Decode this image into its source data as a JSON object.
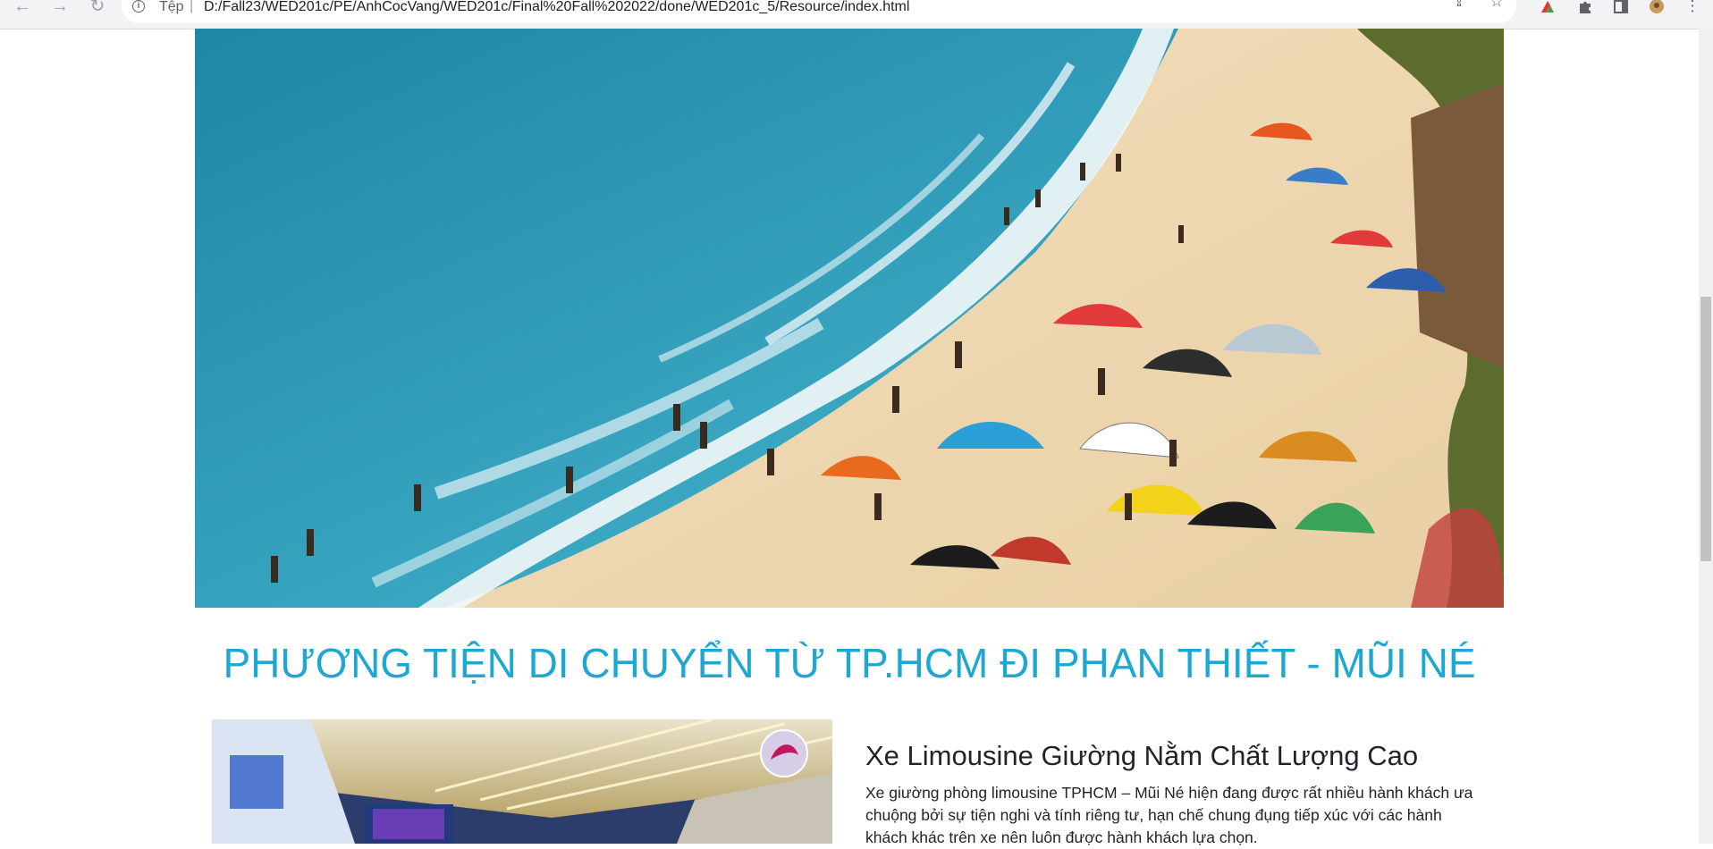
{
  "browser": {
    "nav": {
      "back_icon": "back-arrow-icon",
      "forward_icon": "forward-arrow-icon",
      "reload_icon": "reload-icon"
    },
    "address_bar": {
      "scheme_label": "Tệp",
      "separator": "|",
      "url": "D:/Fall23/WED201c/PE/AnhCocVang/WED201c/Final%20Fall%202022/done/WED201c_5/Resource/index.html"
    },
    "toolbar_icons": [
      "share-icon",
      "bookmark-star-icon",
      "extension-logo-icon",
      "puzzle-extensions-icon",
      "side-panel-icon",
      "profile-avatar-icon",
      "more-menu-icon"
    ]
  },
  "page": {
    "hero_image": {
      "alt": "beach-kitesurf-photo"
    },
    "section_title": "PHƯƠNG TIỆN DI CHUYỂN TỪ TP.HCM ĐI PHAN THIẾT - MŨI NÉ",
    "cards": [
      {
        "image": "limousine-bus-interior-photo",
        "title": "Xe Limousine Giường Nằm Chất Lượng Cao",
        "text": "Xe giường phòng limousine TPHCM – Mũi Né hiện đang được rất nhiều hành khách ưa chuộng bởi sự tiện nghi và tính riêng tư, hạn chế chung đụng tiếp xúc với các hành khách khác trên xe nên luôn được hành khách lựa chọn."
      }
    ]
  },
  "colors": {
    "title_accent": "#1ea7d0",
    "body_text": "#212529",
    "sea": "#2f97b6",
    "sand": "#efd9b5"
  }
}
